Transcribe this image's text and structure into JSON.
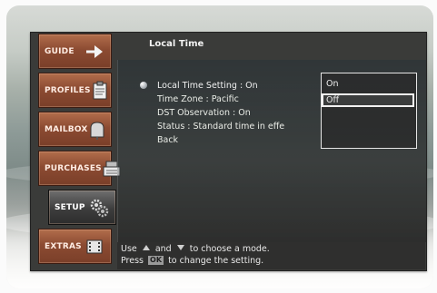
{
  "menu": {
    "tabs": [
      {
        "label": "GUIDE",
        "icon": "arrow-right-icon",
        "active": false
      },
      {
        "label": "PROFILES",
        "icon": "clipboard-icon",
        "active": false
      },
      {
        "label": "MAILBOX",
        "icon": "mailbox-icon",
        "active": false
      },
      {
        "label": "PURCHASES",
        "icon": "cash-register-icon",
        "active": false
      },
      {
        "label": "SETUP",
        "icon": "gears-icon",
        "active": true
      },
      {
        "label": "EXTRAS",
        "icon": "film-icon",
        "active": false
      }
    ]
  },
  "screen": {
    "title": "Local Time",
    "items": [
      "Local Time Setting : On",
      "Time Zone : Pacific",
      "DST Observation : On",
      "Status : Standard time in effe",
      "Back"
    ],
    "options": [
      "On",
      "Off"
    ],
    "selected_option": "Off"
  },
  "help": {
    "line1_prefix": "Use",
    "line1_mid": "and",
    "line1_suffix": "to choose a mode.",
    "line2_prefix": "Press",
    "ok_label": "OK",
    "line2_suffix": "to change the setting."
  }
}
